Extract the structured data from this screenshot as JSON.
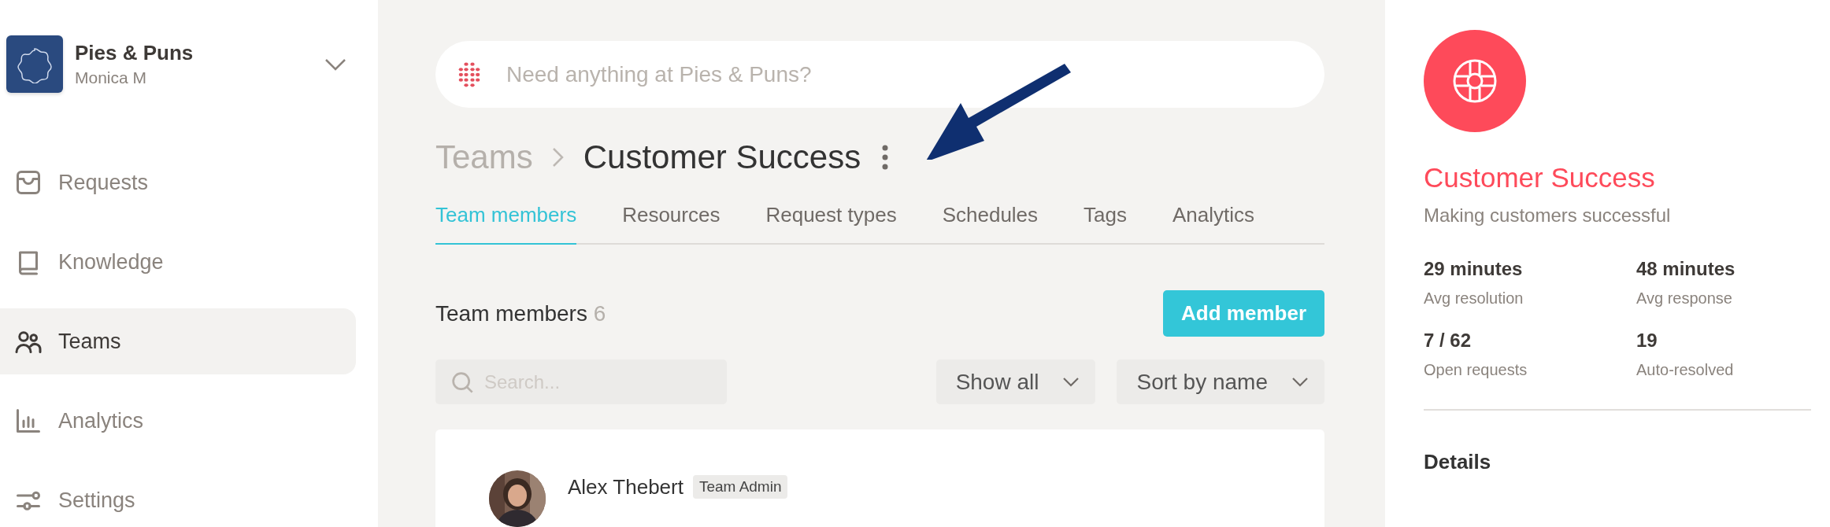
{
  "org": {
    "name": "Pies & Puns",
    "user": "Monica M"
  },
  "nav": [
    {
      "label": "Requests",
      "selected": false
    },
    {
      "label": "Knowledge",
      "selected": false
    },
    {
      "label": "Teams",
      "selected": true
    },
    {
      "label": "Analytics",
      "selected": false
    },
    {
      "label": "Settings",
      "selected": false
    }
  ],
  "search": {
    "placeholder": "Need anything at Pies & Puns?"
  },
  "breadcrumb": [
    {
      "label": "Teams",
      "selected": false
    },
    {
      "label": "Customer Success",
      "selected": true
    }
  ],
  "annotation": {
    "kind": "arrow"
  },
  "tabs": [
    {
      "label": "Team members",
      "selected": true
    },
    {
      "label": "Resources",
      "selected": false
    },
    {
      "label": "Request types",
      "selected": false
    },
    {
      "label": "Schedules",
      "selected": false
    },
    {
      "label": "Tags",
      "selected": false
    },
    {
      "label": "Analytics",
      "selected": false
    }
  ],
  "members": {
    "title": "Team members",
    "count": "6",
    "add_button": "Add member",
    "search_placeholder": "Search...",
    "filter": "Show all",
    "sort": "Sort by name",
    "rows": [
      {
        "name": "Alex Thebert",
        "badge": "Team Admin"
      }
    ]
  },
  "team": {
    "name": "Customer Success",
    "description": "Making customers successful",
    "stats": [
      {
        "value": "29 minutes",
        "label": "Avg resolution"
      },
      {
        "value": "48 minutes",
        "label": "Avg response"
      },
      {
        "value": "7 / 62",
        "label": "Open requests"
      },
      {
        "value": "19",
        "label": "Auto-resolved"
      }
    ],
    "details_title": "Details"
  }
}
